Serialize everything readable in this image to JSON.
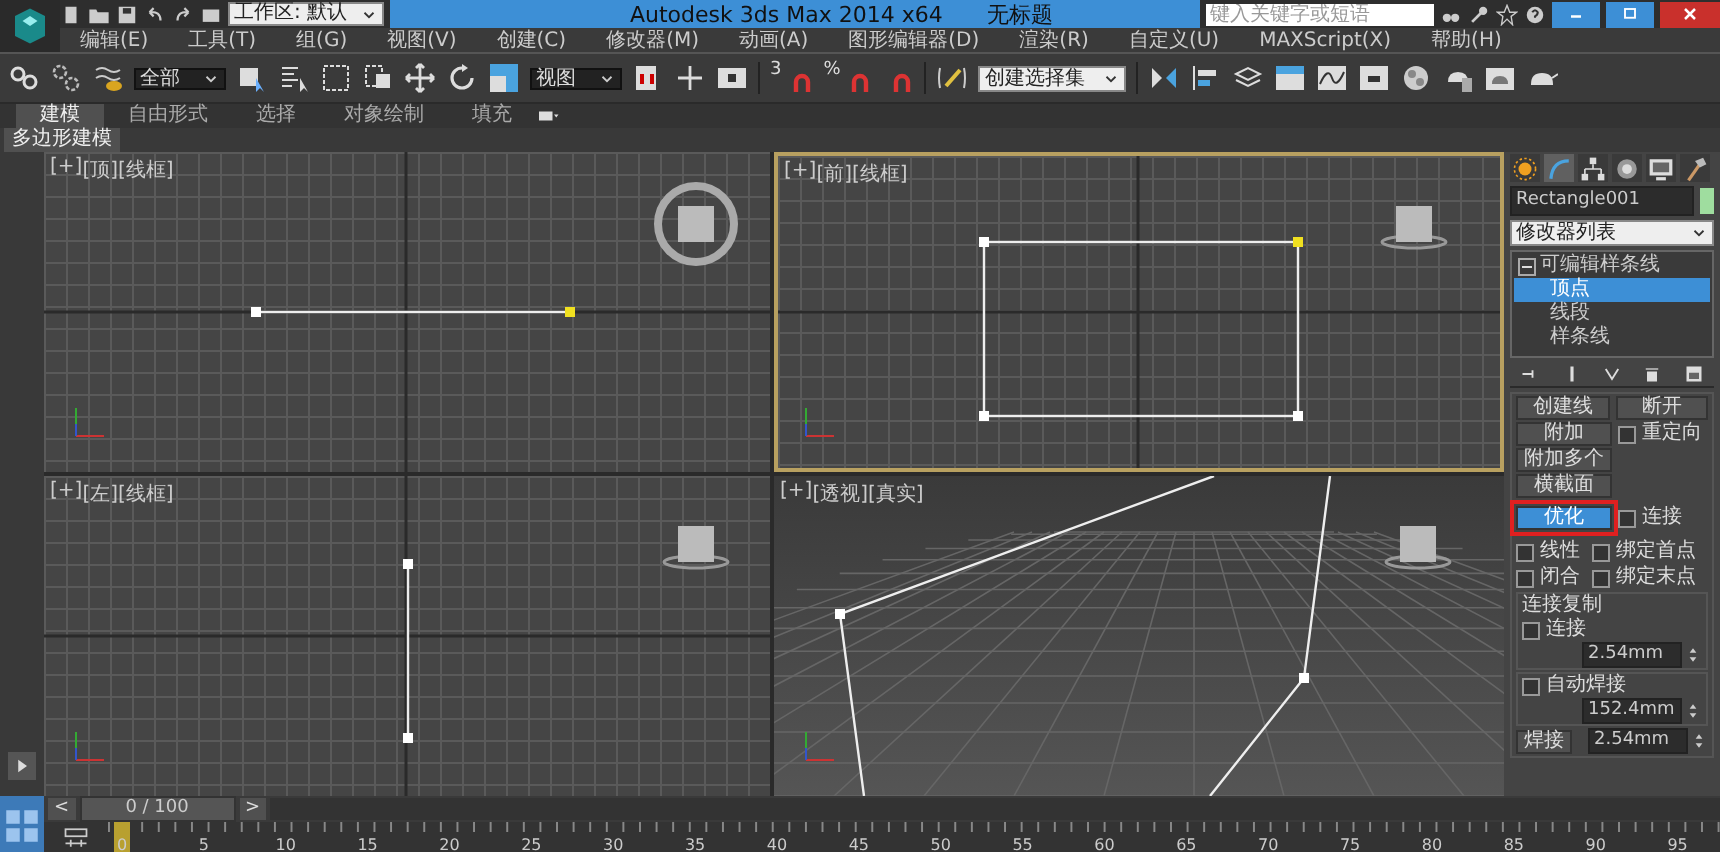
{
  "title_bar": {
    "workspace": "工作区: 默认",
    "title": "Autodesk 3ds Max  2014 x64",
    "document": "无标题",
    "search": {
      "placeholder": "键入关键字或短语"
    }
  },
  "menu": [
    "编辑(E)",
    "工具(T)",
    "组(G)",
    "视图(V)",
    "创建(C)",
    "修改器(M)",
    "动画(A)",
    "图形编辑器(D)",
    "渲染(R)",
    "自定义(U)",
    "MAXScript(X)",
    "帮助(H)"
  ],
  "toolbar": {
    "selection_filter": "全部",
    "reference_coord": "视图",
    "snap_labels": [
      "3",
      "%"
    ],
    "named_selection": "创建选择集"
  },
  "ribbon": {
    "tabs": [
      {
        "label": "建模",
        "selected": true
      },
      {
        "label": "自由形式",
        "selected": false
      },
      {
        "label": "选择",
        "selected": false
      },
      {
        "label": "对象绘制",
        "selected": false
      },
      {
        "label": "填充",
        "selected": false
      }
    ],
    "panel": "多边形建模"
  },
  "viewports": [
    {
      "kind": "top",
      "labels": [
        "[+]",
        "[顶]",
        "[线框]"
      ],
      "selected": false
    },
    {
      "kind": "front",
      "labels": [
        "[+]",
        "[前]",
        "[线框]"
      ],
      "selected": true
    },
    {
      "kind": "left",
      "labels": [
        "[+]",
        "[左]",
        "[线框]"
      ],
      "selected": false
    },
    {
      "kind": "perspective",
      "labels": [
        "[+]",
        "[透视]",
        "[真实]"
      ],
      "selected": false
    }
  ],
  "command_panel": {
    "tabs": [
      {
        "selected": false
      },
      {
        "selected": true
      },
      {
        "selected": false
      },
      {
        "selected": false
      },
      {
        "selected": false
      },
      {
        "selected": false
      }
    ],
    "object_name": "Rectangle001",
    "modifier_list": "修改器列表",
    "stack": [
      {
        "label": "可编辑样条线",
        "expanded": true,
        "selected": false,
        "children": [
          {
            "label": "顶点",
            "selected": true
          },
          {
            "label": "线段",
            "selected": false
          },
          {
            "label": "样条线",
            "selected": false
          }
        ]
      }
    ],
    "geometry": {
      "create_line": "创建线",
      "break": "断开",
      "attach": "附加",
      "reorient": {
        "label": "重定向",
        "checked": false
      },
      "attach_mult": "附加多个",
      "cross_section": "横截面",
      "refine": {
        "label": "优化",
        "on": true,
        "highlighted": true
      },
      "connect": {
        "label": "连接",
        "checked": false
      },
      "linear": {
        "label": "线性",
        "checked": false
      },
      "bind_first": {
        "label": "绑定首点",
        "checked": false
      },
      "closed": {
        "label": "闭合",
        "checked": false
      },
      "bind_last": {
        "label": "绑定末点",
        "checked": false
      },
      "connect_copy": {
        "title": "连接复制",
        "connect": {
          "label": "连接",
          "checked": false
        },
        "threshold": "2.54mm"
      },
      "auto_weld": {
        "label": "自动焊接",
        "checked": false
      },
      "auto_weld_threshold": "152.4mm",
      "weld": "焊接",
      "weld_threshold": "2.54mm"
    }
  },
  "time_slider": {
    "prev": "<",
    "position": "0 / 100",
    "next": ">"
  },
  "timeline": {
    "ticks": [
      "0",
      "5",
      "10",
      "15",
      "20",
      "25",
      "30",
      "35",
      "40",
      "45",
      "50",
      "55",
      "60",
      "65",
      "70",
      "75",
      "80",
      "85",
      "90",
      "95"
    ]
  }
}
